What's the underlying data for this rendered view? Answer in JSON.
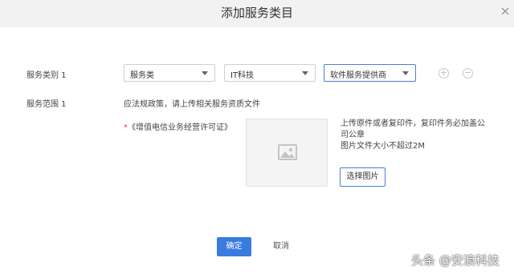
{
  "dialog": {
    "title": "添加服务类目",
    "close_icon": "close-icon"
  },
  "category_row": {
    "label": "服务类别 1",
    "selects": [
      {
        "value": "服务类"
      },
      {
        "value": "IT科技"
      },
      {
        "value": "软件服务提供商"
      }
    ],
    "add_icon": "plus-circle-icon",
    "remove_icon": "minus-circle-icon"
  },
  "scope_row": {
    "label": "服务范围 1",
    "description": "应法规政策，请上传相关服务资质文件"
  },
  "upload": {
    "required_mark": "*",
    "doc_label": "《增值电信业务经营许可证》",
    "placeholder_icon": "image-icon",
    "hint_lines": [
      "上传原件或者复印件，复印件务必加盖公",
      "司公章",
      "图片文件大小不超过2M"
    ],
    "pick_button": "选择图片"
  },
  "footer": {
    "ok": "确定",
    "cancel": "取消"
  },
  "watermark": "头条 @安浪科技",
  "colors": {
    "primary": "#3a7be0",
    "header_bg": "#f2f2f2",
    "required": "#e04a3b"
  }
}
